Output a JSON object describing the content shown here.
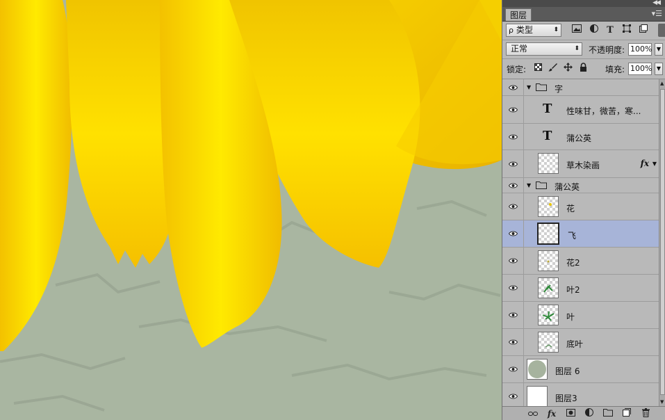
{
  "panel": {
    "tab_label": "图层",
    "filter": {
      "selected": "类型"
    },
    "blend_mode": "正常",
    "opacity_label": "不透明度:",
    "opacity_value": "100%",
    "lock_label": "锁定:",
    "fill_label": "填充:",
    "fill_value": "100%"
  },
  "layers": [
    {
      "name": "字",
      "kind": "group",
      "expanded": true
    },
    {
      "name": "性味甘，微苦，寒...",
      "kind": "text"
    },
    {
      "name": "蒲公英",
      "kind": "text"
    },
    {
      "name": "草木染画",
      "kind": "pixel",
      "has_fx": true,
      "fx_label": "fx"
    },
    {
      "name": "蒲公英",
      "kind": "group",
      "expanded": true
    },
    {
      "name": "花",
      "kind": "pixel"
    },
    {
      "name": "飞",
      "kind": "pixel",
      "selected": true
    },
    {
      "name": "花2",
      "kind": "pixel"
    },
    {
      "name": "叶2",
      "kind": "pixel"
    },
    {
      "name": "叶",
      "kind": "pixel"
    },
    {
      "name": "底叶",
      "kind": "pixel"
    },
    {
      "name": "图层 6",
      "kind": "pixel"
    },
    {
      "name": "图层3",
      "kind": "pixel"
    }
  ],
  "bottom_bar": {
    "fx_label": "fx"
  },
  "colors": {
    "selected_row": "#a7b4d8",
    "panel_bg": "#b9b9b9",
    "canvas_bg": "#a9b6a1",
    "petal_yellow": "#f7cf00"
  }
}
